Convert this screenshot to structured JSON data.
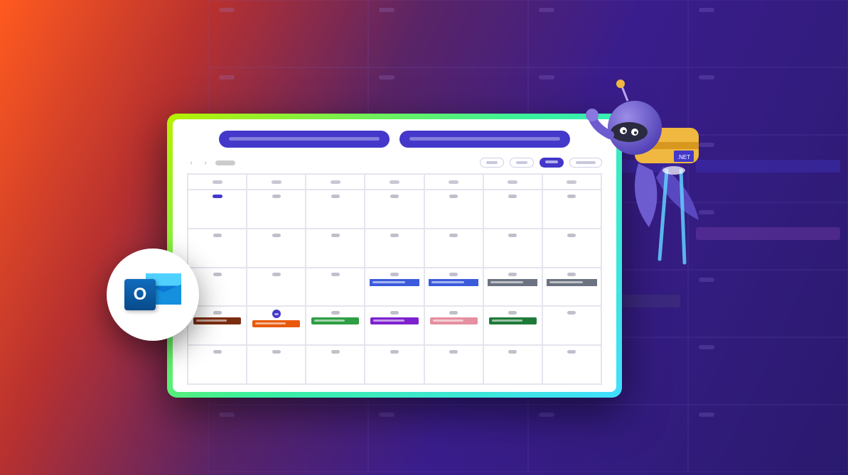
{
  "background_grid": {
    "cols": 4,
    "rows": 7,
    "events": [
      {
        "row": 3,
        "col": 3,
        "kind": "blue"
      },
      {
        "row": 3,
        "col": 4,
        "kind": "blue"
      },
      {
        "row": 4,
        "col": 4,
        "kind": "pink"
      },
      {
        "row": 5,
        "col": 2,
        "kind": "gray"
      },
      {
        "row": 5,
        "col": 3,
        "kind": "gray"
      }
    ]
  },
  "card": {
    "header_pill_count": 2,
    "toolbar": {
      "nav_prev": "‹",
      "nav_next": "›",
      "title_chip": "—",
      "buttons": [
        "outline",
        "outline",
        "filled",
        "outline"
      ]
    },
    "calendar": {
      "columns": 7,
      "weeks": 5,
      "day_headers": [
        "",
        "",
        "",
        "",
        "",
        "",
        ""
      ],
      "week0_first_cell_has_dark_date": true,
      "today_cell": {
        "week": 3,
        "col": 1
      },
      "events": [
        {
          "week": 2,
          "col": 3,
          "color": "blue",
          "span": true
        },
        {
          "week": 2,
          "col": 4,
          "color": "blue",
          "span": true
        },
        {
          "week": 2,
          "col": 5,
          "color": "gray",
          "span": true
        },
        {
          "week": 2,
          "col": 6,
          "color": "gray",
          "span": true
        },
        {
          "week": 3,
          "col": 0,
          "color": "brown"
        },
        {
          "week": 3,
          "col": 1,
          "color": "orange"
        },
        {
          "week": 3,
          "col": 2,
          "color": "green"
        },
        {
          "week": 3,
          "col": 3,
          "color": "purple"
        },
        {
          "week": 3,
          "col": 4,
          "color": "pink"
        },
        {
          "week": 3,
          "col": 5,
          "color": "dgreen"
        }
      ]
    }
  },
  "outlook": {
    "label": "O"
  },
  "mascot": {
    "badge": ".NET"
  },
  "colors": {
    "primary": "#4338ca",
    "accent_gradient": [
      "#b8f000",
      "#38f0a0",
      "#40e0ff"
    ]
  }
}
